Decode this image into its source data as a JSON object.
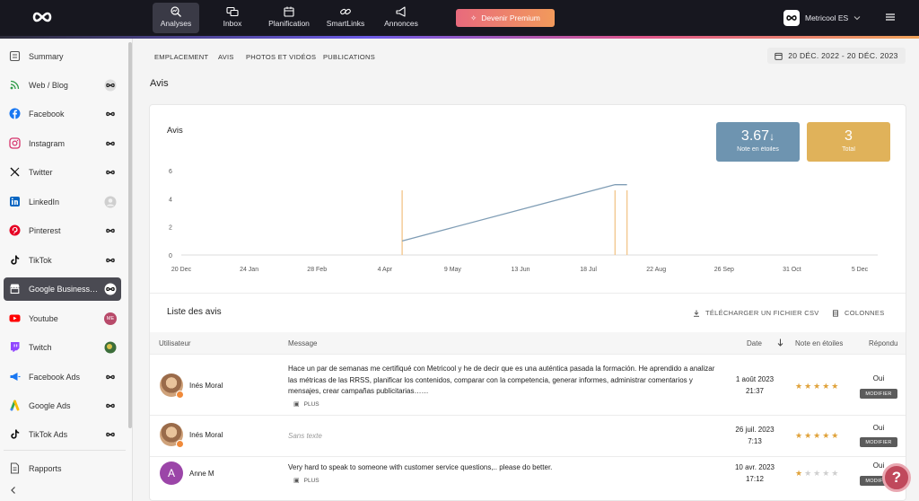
{
  "topbar": {
    "nav": [
      {
        "label": "Analyses",
        "icon": "analytics-icon",
        "active": true
      },
      {
        "label": "Inbox",
        "icon": "inbox-icon"
      },
      {
        "label": "Planification",
        "icon": "calendar-icon"
      },
      {
        "label": "SmartLinks",
        "icon": "link-icon"
      },
      {
        "label": "Annonces",
        "icon": "megaphone-icon"
      }
    ],
    "premium_label": "Devenir Premium",
    "account_name": "Metricool ES"
  },
  "sidebar": {
    "items": [
      {
        "label": "Summary",
        "icon": "summary-icon"
      },
      {
        "label": "Web / Blog",
        "icon": "rss-icon"
      },
      {
        "label": "Facebook",
        "icon": "facebook-icon"
      },
      {
        "label": "Instagram",
        "icon": "instagram-icon"
      },
      {
        "label": "Twitter",
        "icon": "x-icon"
      },
      {
        "label": "LinkedIn",
        "icon": "linkedin-icon"
      },
      {
        "label": "Pinterest",
        "icon": "pinterest-icon"
      },
      {
        "label": "TikTok",
        "icon": "tiktok-icon"
      },
      {
        "label": "Google Business Profile",
        "icon": "google-business-icon",
        "active": true
      },
      {
        "label": "Youtube",
        "icon": "youtube-icon",
        "badge_text": "ME"
      },
      {
        "label": "Twitch",
        "icon": "twitch-icon"
      },
      {
        "label": "Facebook Ads",
        "icon": "facebook-ads-icon"
      },
      {
        "label": "Google Ads",
        "icon": "google-ads-icon"
      },
      {
        "label": "TikTok Ads",
        "icon": "tiktok-ads-icon"
      }
    ],
    "footer_item": {
      "label": "Rapports",
      "icon": "reports-icon"
    }
  },
  "subtabs": [
    "EMPLACEMENT",
    "AVIS",
    "PHOTOS ET VIDÉOS",
    "PUBLICATIONS"
  ],
  "date_range": "20 DÉC. 2022 - 20 DÉC. 2023",
  "page_title": "Avis",
  "chart": {
    "title": "Avis",
    "kpis": [
      {
        "value": "3.67",
        "trend": "down",
        "label": "Note en étoiles",
        "color": "#6e94b0"
      },
      {
        "value": "3",
        "label": "Total",
        "color": "#e0b25a"
      }
    ]
  },
  "chart_data": {
    "type": "line",
    "title": "Avis",
    "x_ticks": [
      "20 Dec",
      "24 Jan",
      "28 Feb",
      "4 Apr",
      "9 May",
      "13 Jun",
      "18 Jul",
      "22 Aug",
      "26 Sep",
      "31 Oct",
      "5 Dec"
    ],
    "y_ticks": [
      0,
      2,
      4,
      6
    ],
    "ylim": [
      0,
      6
    ],
    "series": [
      {
        "kind": "line",
        "color": "#7f9db5",
        "points": [
          [
            "2023-04-10",
            1
          ],
          [
            "2023-07-26",
            5
          ],
          [
            "2023-08-01",
            5
          ]
        ]
      },
      {
        "kind": "bars",
        "color": "#f3c890",
        "points": [
          [
            "2023-04-10",
            4.6
          ],
          [
            "2023-07-26",
            4.6
          ],
          [
            "2023-08-01",
            4.6
          ]
        ]
      }
    ]
  },
  "list": {
    "title": "Liste des avis",
    "download_label": "TÉLÉCHARGER UN FICHIER CSV",
    "columns_label": "COLONNES",
    "headers": {
      "user": "Utilisateur",
      "message": "Message",
      "date": "Date",
      "rating": "Note en étoiles",
      "replied": "Répondu"
    },
    "plus_label": "PLUS",
    "modify_label": "MODIFIER",
    "rows": [
      {
        "user": "Inés Moral",
        "avatar": "photo",
        "message": "Hace un par de semanas me certifiqué con Metricool y he de decir que es una auténtica pasada la formación. He aprendido a analizar las métricas de las RRSS, planificar los contenidos, comparar con la competencia, generar informes, administrar comentarios y mensajes, crear campañas publicitarias……",
        "has_plus": true,
        "date": "1 août 2023",
        "time": "21:37",
        "rating": 5,
        "replied": "Oui"
      },
      {
        "user": "Inés Moral",
        "avatar": "photo",
        "message": "Sans texte",
        "empty": true,
        "date": "26 juil. 2023",
        "time": "7:13",
        "rating": 5,
        "replied": "Oui"
      },
      {
        "user": "Anne M",
        "avatar": "letter",
        "initial": "A",
        "message": "Very hard to speak to someone with customer service questions,.. please do better.",
        "has_plus": true,
        "date": "10 avr. 2023",
        "time": "17:12",
        "rating": 1,
        "replied": "Oui"
      }
    ]
  }
}
